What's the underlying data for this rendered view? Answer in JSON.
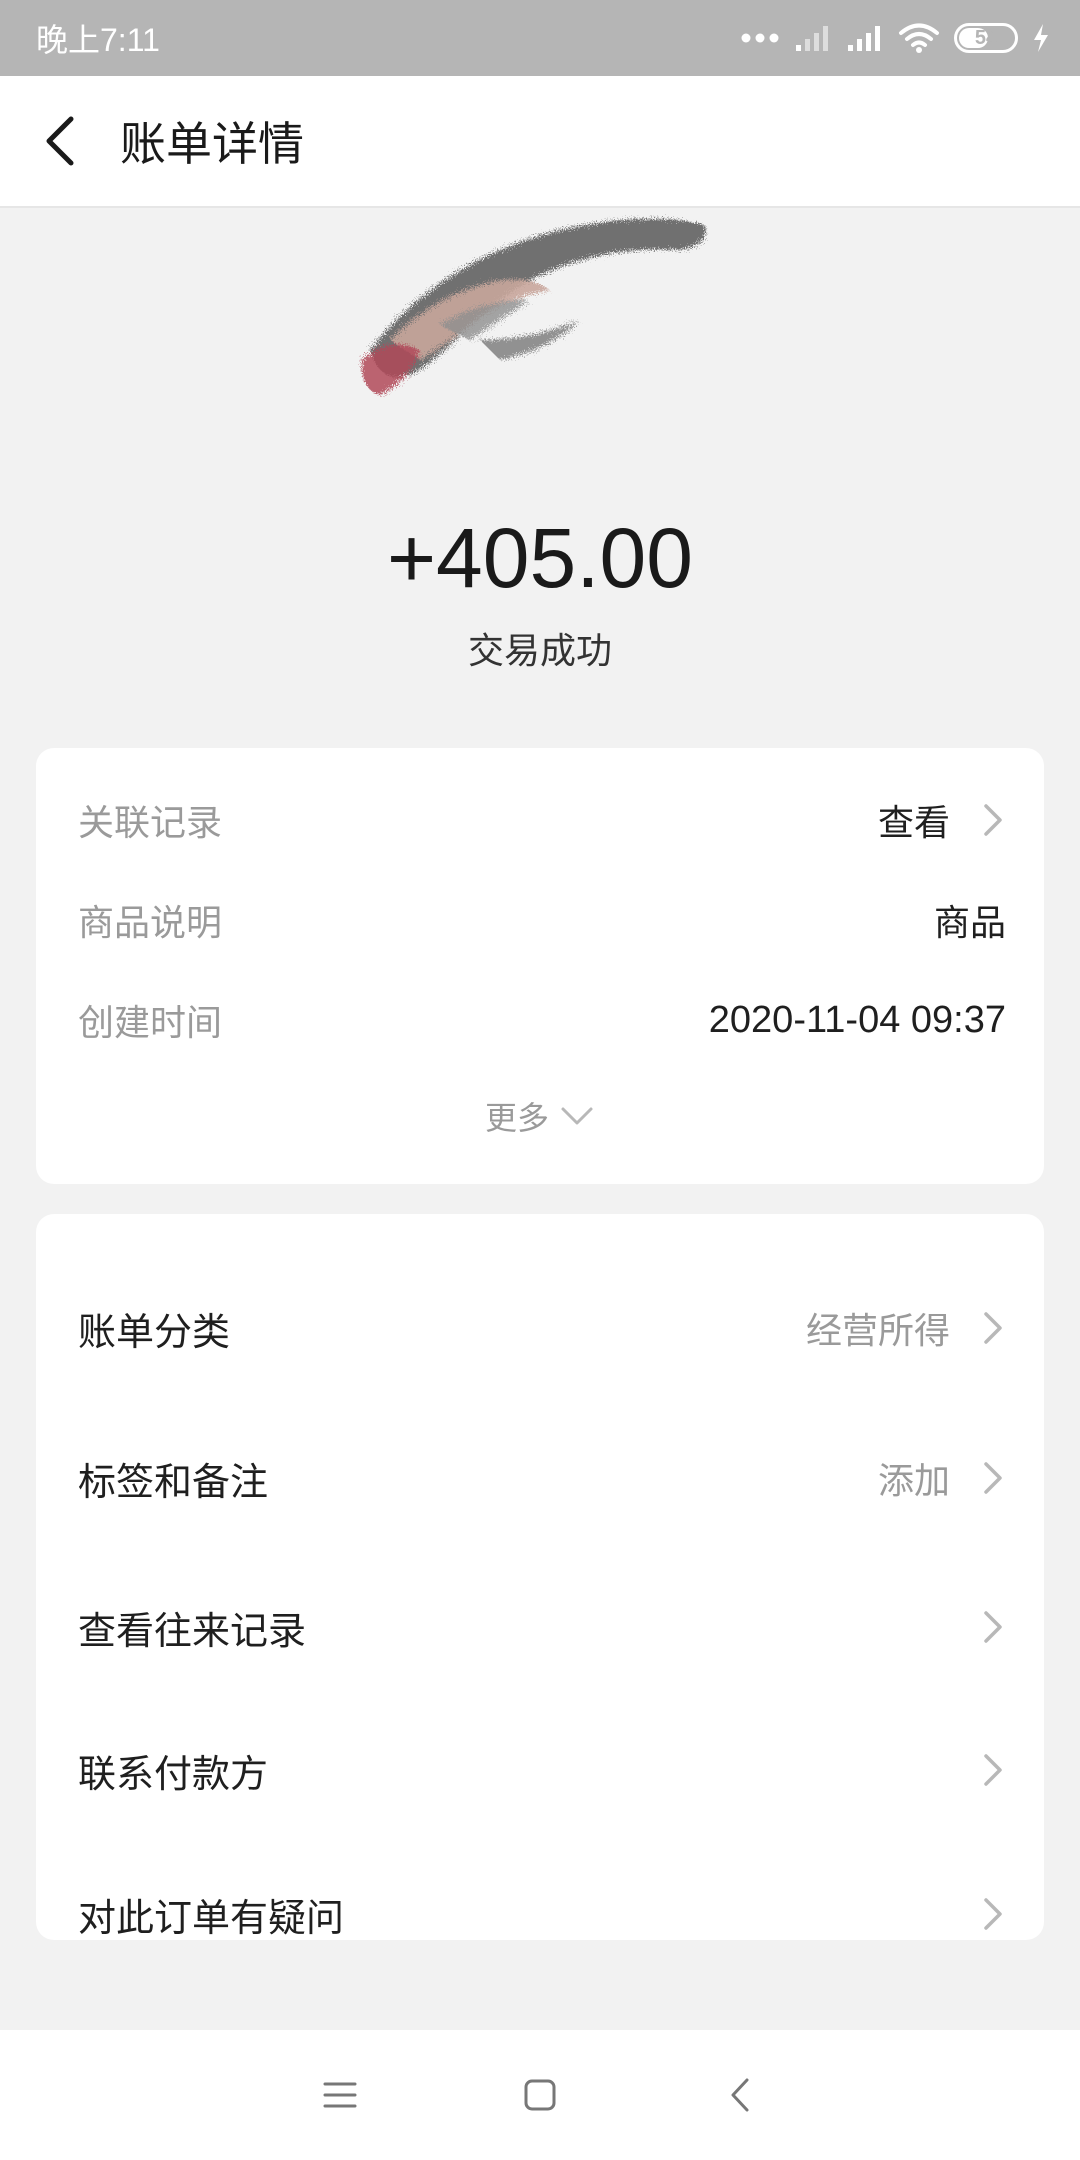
{
  "status_bar": {
    "time": "晚上7:11",
    "battery": "54",
    "battery_level_percent": 54,
    "icons": [
      "dots-icon",
      "signal-weak-icon",
      "signal-icon",
      "wifi-icon",
      "battery-icon",
      "charging-icon"
    ]
  },
  "header": {
    "title": "账单详情",
    "back_icon": "back-chevron-icon"
  },
  "summary": {
    "amount": "+405.00",
    "status": "交易成功"
  },
  "details": {
    "rows": [
      {
        "label": "关联记录",
        "value": "查看",
        "has_chevron": true
      },
      {
        "label": "商品说明",
        "value": "商品",
        "has_chevron": false
      },
      {
        "label": "创建时间",
        "value": "2020-11-04 09:37",
        "has_chevron": false
      }
    ],
    "more_label": "更多"
  },
  "menu": {
    "items": [
      {
        "label": "账单分类",
        "value": "经营所得"
      },
      {
        "label": "标签和备注",
        "value": "添加"
      },
      {
        "label": "查看往来记录",
        "value": ""
      },
      {
        "label": "联系付款方",
        "value": ""
      },
      {
        "label": "对此订单有疑问",
        "value": ""
      }
    ]
  },
  "nav": {
    "icons": [
      "menu-icon",
      "home-icon",
      "back-icon"
    ]
  },
  "colors": {
    "background": "#f2f2f2",
    "card": "#ffffff",
    "secondary_text": "#9a9a9a",
    "status_bar": "#b5b5b5"
  }
}
